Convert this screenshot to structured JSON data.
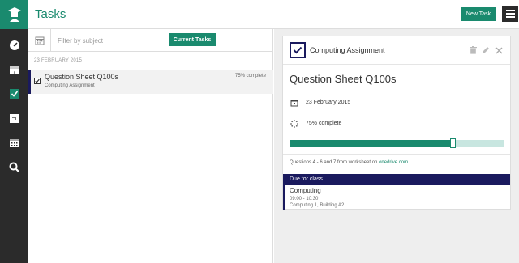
{
  "app": {
    "title": "Tasks"
  },
  "header": {
    "new_task_label": "New Task"
  },
  "colors": {
    "accent": "#1a8a6e",
    "sidebar": "#2b2b2b",
    "navy": "#1a1a5e"
  },
  "sidebar": {
    "items": [
      {
        "icon": "dashboard-icon"
      },
      {
        "icon": "calendar-day-icon"
      },
      {
        "icon": "check-square-icon"
      },
      {
        "icon": "note-icon"
      },
      {
        "icon": "timetable-icon"
      },
      {
        "icon": "search-icon"
      }
    ]
  },
  "filter": {
    "placeholder": "Filter by subject",
    "current_tasks_label": "Current Tasks"
  },
  "list": {
    "date_heading": "23 FEBRUARY 2015",
    "tasks": [
      {
        "title": "Question Sheet Q100s",
        "subject": "Computing Assignment",
        "progress_text": "75% complete"
      }
    ]
  },
  "detail": {
    "subject": "Computing Assignment",
    "title": "Question Sheet Q100s",
    "due_date": "23 February 2015",
    "progress_text": "75% complete",
    "progress_fraction": 0.76,
    "note_text": "Questions 4 - 6 and 7 from worksheet on",
    "note_link": "onedrive.com",
    "due_heading": "Due for class",
    "due_class": "Computing",
    "due_time": "09:00 - 10:30",
    "due_location": "Computing 1, Building A2"
  }
}
